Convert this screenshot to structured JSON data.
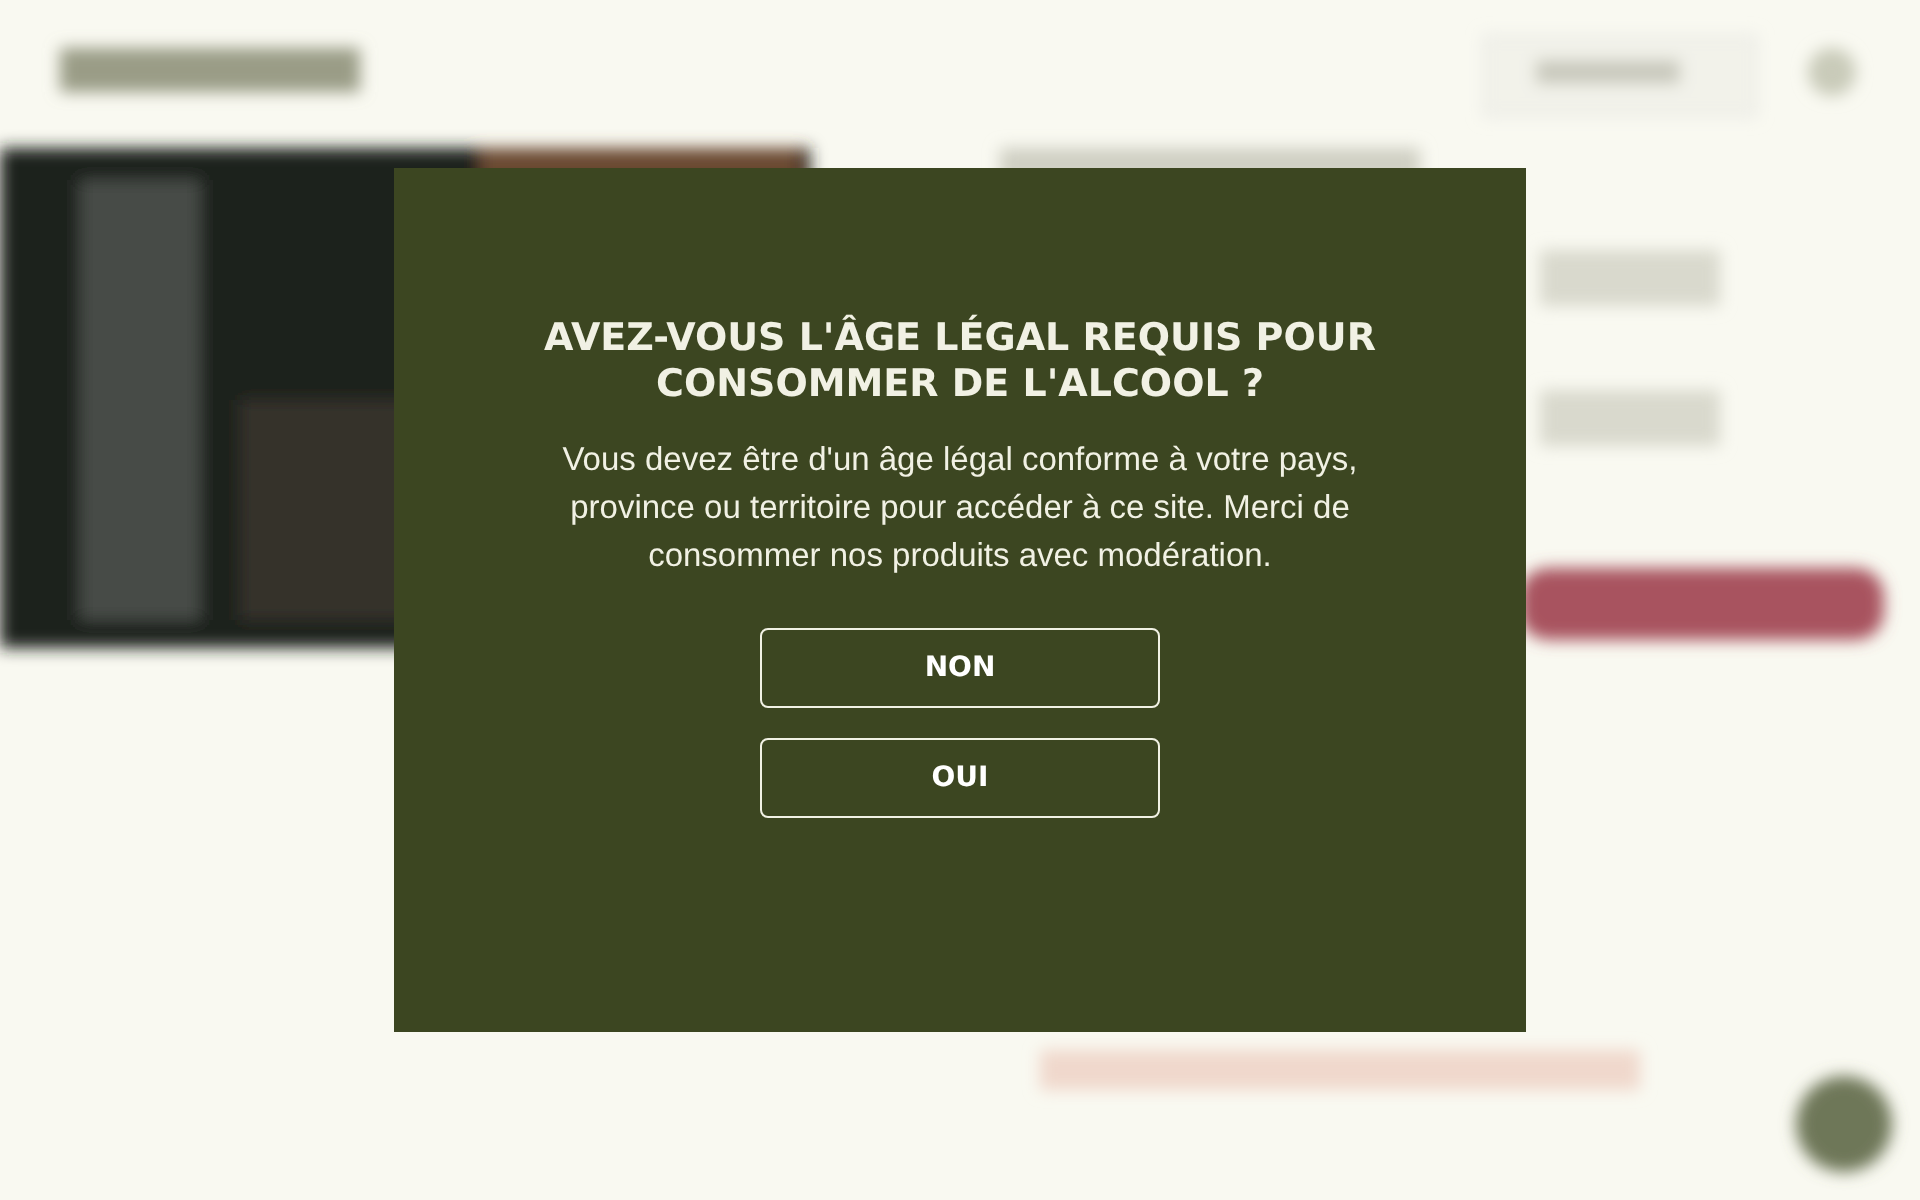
{
  "age_gate": {
    "title": "AVEZ-VOUS L'ÂGE LÉGAL REQUIS POUR CONSOMMER DE L'ALCOOL ?",
    "message": "Vous devez être d'un âge légal conforme à votre pays, province ou territoire pour accéder à ce site. Merci de consommer nos produits avec modération.",
    "buttons": [
      "NON",
      "OUI"
    ]
  }
}
